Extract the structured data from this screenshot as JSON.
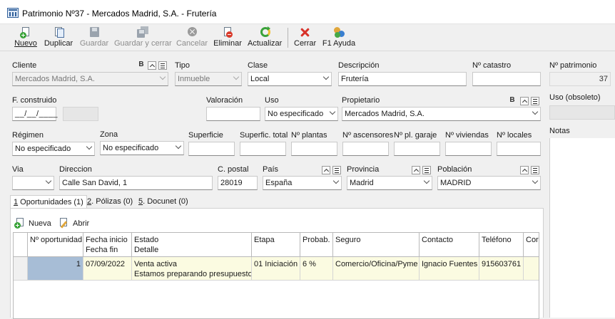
{
  "window": {
    "title": "Patrimonio Nº37 - Mercados Madrid, S.A. - Frutería"
  },
  "toolbar": {
    "buttons": [
      {
        "label": "Nuevo",
        "icon": "new-doc-icon",
        "enabled": true
      },
      {
        "label": "Duplicar",
        "icon": "duplicate-icon",
        "enabled": true
      },
      {
        "label": "Guardar",
        "icon": "save-icon",
        "enabled": false
      },
      {
        "label": "Guardar y cerrar",
        "icon": "save-close-icon",
        "enabled": false
      },
      {
        "label": "Cancelar",
        "icon": "cancel-icon",
        "enabled": false
      },
      {
        "label": "Eliminar",
        "icon": "delete-icon",
        "enabled": true
      },
      {
        "label": "Actualizar",
        "icon": "refresh-icon",
        "enabled": true
      },
      {
        "label": "Cerrar",
        "icon": "close-icon",
        "enabled": true
      },
      {
        "label": "F1 Ayuda",
        "icon": "help-icon",
        "enabled": true
      }
    ]
  },
  "form": {
    "cliente": {
      "label": "Cliente",
      "value": "Mercados Madrid, S.A.",
      "flag": "B"
    },
    "tipo": {
      "label": "Tipo",
      "value": "Inmueble"
    },
    "clase": {
      "label": "Clase",
      "value": "Local"
    },
    "descripcion": {
      "label": "Descripción",
      "value": "Frutería"
    },
    "catastro": {
      "label": "Nº catastro",
      "value": ""
    },
    "f_construido": {
      "label": "F. construido",
      "value": "__/__/____"
    },
    "valoracion": {
      "label": "Valoración",
      "value": ""
    },
    "uso": {
      "label": "Uso",
      "value": "No especificado"
    },
    "propietario": {
      "label": "Propietario",
      "value": "Mercados Madrid, S.A.",
      "flag": "B"
    },
    "regimen": {
      "label": "Régimen",
      "value": "No especificado"
    },
    "zona": {
      "label": "Zona",
      "value": "No especificado"
    },
    "superficie": {
      "label": "Superficie",
      "value": ""
    },
    "superfic_total": {
      "label": "Superfic. total",
      "value": ""
    },
    "n_plantas": {
      "label": "Nº plantas",
      "value": ""
    },
    "n_ascensores": {
      "label": "Nº ascensores",
      "value": ""
    },
    "n_pl_garaje": {
      "label": "Nº pl. garaje",
      "value": ""
    },
    "n_viviendas": {
      "label": "Nº viviendas",
      "value": ""
    },
    "n_locales": {
      "label": "Nº locales",
      "value": ""
    },
    "via": {
      "label": "Via",
      "value": ""
    },
    "direccion": {
      "label": "Direccion",
      "value": "Calle San David, 1"
    },
    "c_postal": {
      "label": "C. postal",
      "value": "28019"
    },
    "pais": {
      "label": "País",
      "value": "España"
    },
    "provincia": {
      "label": "Provincia",
      "value": "Madrid"
    },
    "poblacion": {
      "label": "Población",
      "value": "MADRID"
    }
  },
  "right_panel": {
    "n_patrimonio": {
      "label": "Nº patrimonio",
      "value": "37"
    },
    "uso_obsoleto": {
      "label": "Uso (obsoleto)",
      "value": ""
    },
    "notas": {
      "label": "Notas",
      "value": ""
    }
  },
  "tabs": [
    {
      "key": "1",
      "label": " Oportunidades (1)",
      "active": true
    },
    {
      "key": "2",
      "label": ". Pólizas (0)",
      "active": false
    },
    {
      "key": "5",
      "label": ". Docunet (0)",
      "active": false
    }
  ],
  "subtoolbar": {
    "nueva": "Nueva",
    "abrir": "Abrir"
  },
  "grid": {
    "headers": [
      {
        "l1": "Nº oportunidad",
        "l2": ""
      },
      {
        "l1": "Fecha inicio",
        "l2": "Fecha fin"
      },
      {
        "l1": "Estado",
        "l2": "Detalle"
      },
      {
        "l1": "Etapa",
        "l2": ""
      },
      {
        "l1": "Probab.",
        "l2": ""
      },
      {
        "l1": "Seguro",
        "l2": ""
      },
      {
        "l1": "Contacto",
        "l2": ""
      },
      {
        "l1": "Teléfono",
        "l2": ""
      },
      {
        "l1": "Corr",
        "l2": ""
      }
    ],
    "rows": [
      {
        "n_oportunidad": "1",
        "fecha_inicio": "07/09/2022",
        "fecha_fin": "",
        "estado": "Venta activa",
        "detalle": "Estamos preparando presupuesto",
        "etapa": "01 Iniciación",
        "probab": "6 %",
        "seguro": "Comercio/Oficina/Pyme",
        "contacto": "Ignacio Fuentes",
        "telefono": "915603761",
        "corr": ""
      }
    ]
  },
  "colors": {
    "row_highlight": "#fbfbe1",
    "selected_cell": "#a7bdd6",
    "delete_red": "#d8322a",
    "add_green": "#39a339"
  }
}
